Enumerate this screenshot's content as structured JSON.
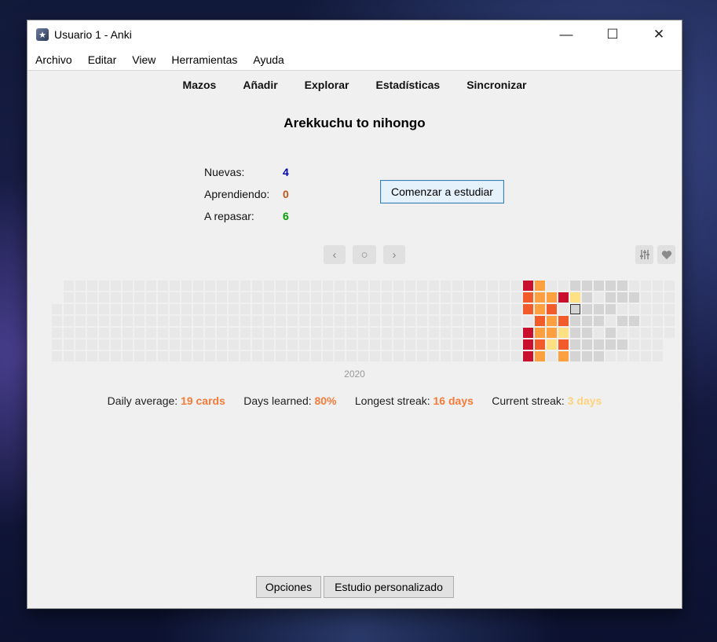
{
  "window": {
    "title": "Usuario 1 - Anki",
    "minimize": "—",
    "maximize": "☐",
    "close": "✕"
  },
  "menu": [
    "Archivo",
    "Editar",
    "View",
    "Herramientas",
    "Ayuda"
  ],
  "toolbar": [
    "Mazos",
    "Añadir",
    "Explorar",
    "Estadísticas",
    "Sincronizar"
  ],
  "deck": {
    "title": "Arekkuchu to nihongo",
    "counts": [
      {
        "label": "Nuevas:",
        "value": "4",
        "color": "#0000aa"
      },
      {
        "label": "Aprendiendo:",
        "value": "0",
        "color": "#c35617"
      },
      {
        "label": "A repasar:",
        "value": "6",
        "color": "#00a000"
      }
    ],
    "study_button": "Comenzar a estudiar"
  },
  "heatmap": {
    "nav": {
      "prev": "‹",
      "today": "○",
      "next": "›"
    },
    "icons": {
      "options": "sliders-icon",
      "donate": "heart-icon"
    },
    "year": "2020",
    "colors": {
      "empty": "#e8e8e8",
      "level1": "#ffe082",
      "level2": "#ffa040",
      "level3": "#f25c2a",
      "level4": "#c8102e",
      "future": "#d4d4d4",
      "today_border": "#333333"
    },
    "active": [
      [
        40,
        0,
        4
      ],
      [
        41,
        0,
        2
      ],
      [
        40,
        1,
        3
      ],
      [
        41,
        1,
        2
      ],
      [
        42,
        1,
        2
      ],
      [
        43,
        1,
        4
      ],
      [
        44,
        1,
        1
      ],
      [
        40,
        2,
        3
      ],
      [
        41,
        2,
        2
      ],
      [
        42,
        2,
        3
      ],
      [
        44,
        2,
        "today"
      ],
      [
        41,
        3,
        3
      ],
      [
        42,
        3,
        2
      ],
      [
        43,
        3,
        3
      ],
      [
        40,
        4,
        4
      ],
      [
        41,
        4,
        2
      ],
      [
        42,
        4,
        2
      ],
      [
        43,
        4,
        1
      ],
      [
        40,
        5,
        4
      ],
      [
        41,
        5,
        3
      ],
      [
        42,
        5,
        1
      ],
      [
        43,
        5,
        3
      ],
      [
        40,
        6,
        4
      ],
      [
        41,
        6,
        2
      ],
      [
        43,
        6,
        2
      ]
    ],
    "future_cells": [
      [
        44,
        0
      ],
      [
        45,
        0
      ],
      [
        46,
        0
      ],
      [
        47,
        0
      ],
      [
        48,
        0
      ],
      [
        45,
        1
      ],
      [
        47,
        1
      ],
      [
        48,
        1
      ],
      [
        49,
        1
      ],
      [
        45,
        2
      ],
      [
        46,
        2
      ],
      [
        47,
        2
      ],
      [
        44,
        3
      ],
      [
        45,
        3
      ],
      [
        46,
        3
      ],
      [
        48,
        3
      ],
      [
        49,
        3
      ],
      [
        44,
        4
      ],
      [
        45,
        4
      ],
      [
        47,
        4
      ],
      [
        44,
        5
      ],
      [
        45,
        5
      ],
      [
        46,
        5
      ],
      [
        47,
        5
      ],
      [
        48,
        5
      ],
      [
        44,
        6
      ],
      [
        45,
        6
      ],
      [
        46,
        6
      ]
    ]
  },
  "stats": {
    "daily_average_label": "Daily average: ",
    "daily_average_value": "19 cards",
    "days_learned_label": "Days learned: ",
    "days_learned_value": "80%",
    "longest_streak_label": "Longest streak: ",
    "longest_streak_value": "16 days",
    "current_streak_label": "Current streak: ",
    "current_streak_value": "3 days",
    "colors": {
      "highlight": "#f47b3a",
      "faded": "#ffd27a"
    }
  },
  "bottom_buttons": {
    "options": "Opciones",
    "custom_study": "Estudio personalizado"
  }
}
